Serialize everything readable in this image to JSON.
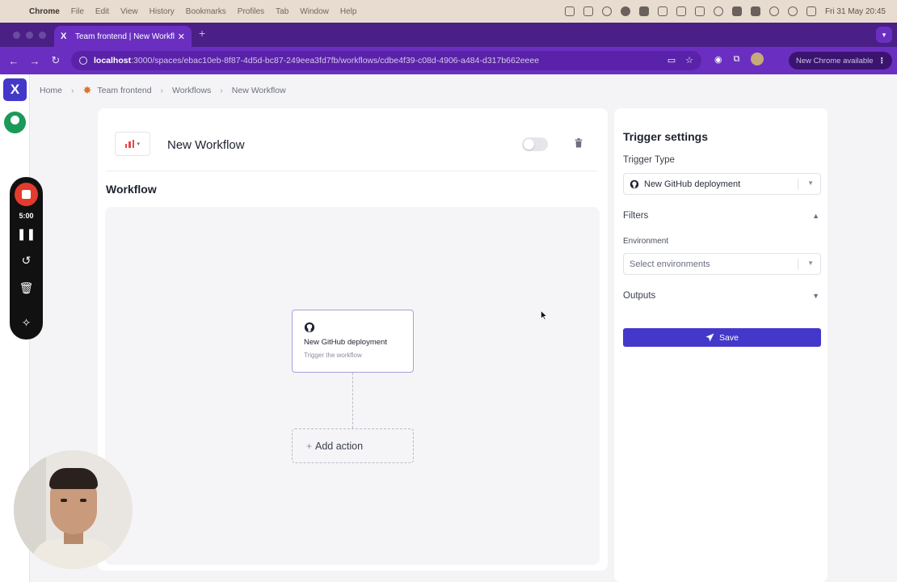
{
  "os_menubar": {
    "app_name": "Chrome",
    "menus": [
      "File",
      "Edit",
      "View",
      "History",
      "Bookmarks",
      "Profiles",
      "Tab",
      "Window",
      "Help"
    ],
    "clock": "Fri 31 May  20:45"
  },
  "browser": {
    "tab_title": "Team frontend | New Workflo",
    "url_host": "localhost",
    "url_path": ":3000/spaces/ebac10eb-8f87-4d5d-bc87-249eea3fd7fb/workflows/cdbe4f39-c08d-4906-a484-d317b662eeee",
    "update_notice": "New Chrome available",
    "accent": "#6a2fc0"
  },
  "app": {
    "logo_letter": "X",
    "brand_color": "#4338ca"
  },
  "recorder": {
    "time": "5:00"
  },
  "breadcrumb": {
    "items": [
      "Home",
      "Team frontend",
      "Workflows",
      "New Workflow"
    ]
  },
  "workflow": {
    "name": "New Workflow",
    "enabled": false,
    "section_title": "Workflow",
    "trigger_node": {
      "title": "New GitHub deployment",
      "subtitle": "Trigger the workflow"
    },
    "add_action_label": "Add action"
  },
  "trigger_settings": {
    "title": "Trigger settings",
    "trigger_type_label": "Trigger Type",
    "trigger_type_value": "New GitHub deployment",
    "filters_label": "Filters",
    "environment_label": "Environment",
    "environment_placeholder": "Select environments",
    "outputs_label": "Outputs",
    "save_label": "Save"
  }
}
